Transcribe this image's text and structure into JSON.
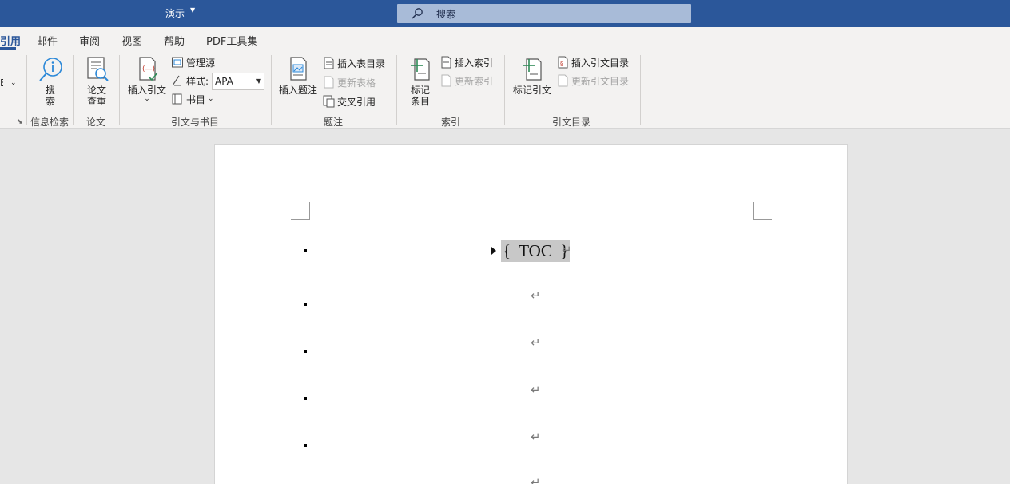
{
  "titlebar": {
    "doc_title": "演示",
    "title_caret": "⌄",
    "search_placeholder": "搜索"
  },
  "tabs": [
    {
      "label": "引用",
      "active": true
    },
    {
      "label": "邮件"
    },
    {
      "label": "审阅"
    },
    {
      "label": "视图"
    },
    {
      "label": "帮助"
    },
    {
      "label": "PDF工具集"
    }
  ],
  "ribbon": {
    "left_partial_label": "E",
    "groups": {
      "info": {
        "label": "信息检索",
        "search_btn": "搜\n索"
      },
      "paper": {
        "label": "论文",
        "check_btn": "论文\n查重"
      },
      "citations": {
        "label": "引文与书目",
        "insert_citation": "插入引文",
        "manage_sources": "管理源",
        "style_label": "样式:",
        "style_value": "APA",
        "bibliography": "书目"
      },
      "captions": {
        "label": "题注",
        "insert_caption": "插入题注",
        "insert_table_of_figures": "插入表目录",
        "update_table": "更新表格",
        "cross_reference": "交叉引用"
      },
      "index": {
        "label": "索引",
        "mark_entry": "标记\n条目",
        "insert_index": "插入索引",
        "update_index": "更新索引"
      },
      "toa": {
        "label": "引文目录",
        "mark_citation": "标记引文",
        "insert_toa": "插入引文目录",
        "update_toa": "更新引文目录"
      }
    }
  },
  "document": {
    "toc_field": "{  TOC  }",
    "para_mark": "↵",
    "bullet_rows": 5
  }
}
